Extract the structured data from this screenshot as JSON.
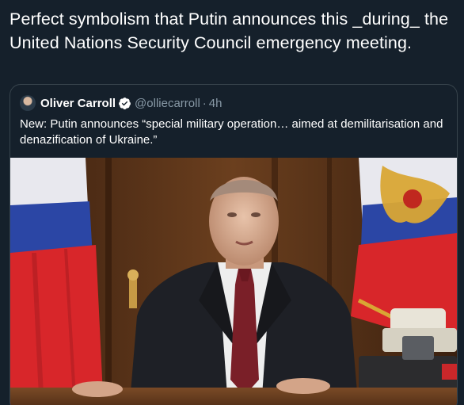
{
  "tweet": {
    "text": "Perfect symbolism that Putin announces this _during_ the United Nations Security Council emergency meeting."
  },
  "quoted_tweet": {
    "author_name": "Oliver Carroll",
    "verified_icon": "verified-badge",
    "handle": "@olliecarroll",
    "separator": "·",
    "time": "4h",
    "text": "New: Putin announces “special military operation…  aimed at demilitarisation and denazification of Ukraine.”"
  },
  "colors": {
    "background": "#15202b",
    "border": "#38444d",
    "secondary_text": "#8899a6",
    "primary_text": "#ffffff"
  }
}
